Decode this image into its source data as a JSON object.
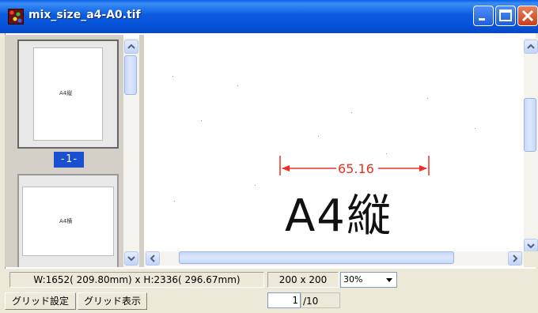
{
  "window": {
    "title": "mix_size_a4-A0.tif"
  },
  "thumbnails": [
    {
      "label": "A4縦",
      "selected": true
    },
    {
      "label": "A4横",
      "selected": false
    }
  ],
  "page_badge": "-1-",
  "viewer": {
    "measure_value": "65.16",
    "page_text": "A4縦"
  },
  "status": {
    "dimensions": "W:1652( 209.80mm) x H:2336( 296.67mm)",
    "dpi": "200 x 200",
    "zoom": "30%",
    "current_page": "1",
    "total_pages": "/10"
  },
  "buttons": {
    "grid_settings": "グリッド設定",
    "grid_display": "グリッド表示"
  },
  "colors": {
    "title_bar": "#0A5FE8",
    "measure": "#E83020",
    "page_badge": "#1A4FD0"
  }
}
